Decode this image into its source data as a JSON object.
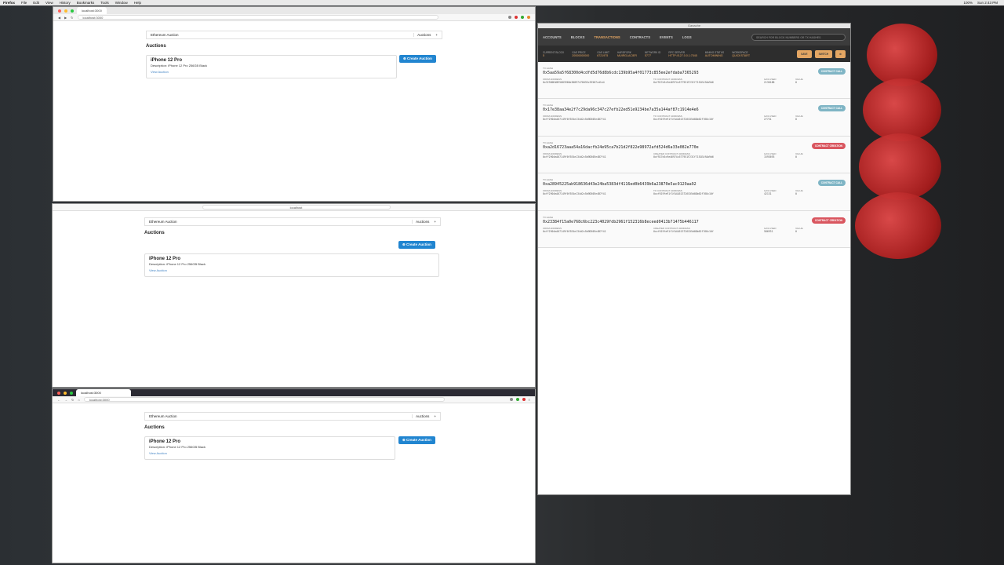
{
  "menubar": {
    "items": [
      "Firefox",
      "File",
      "Edit",
      "View",
      "History",
      "Bookmarks",
      "Tools",
      "Window",
      "Help"
    ],
    "right": [
      "100%",
      "Sun 2:43 PM"
    ]
  },
  "windows": [
    {
      "tab": "localhost:3000",
      "url": "localhost:3000",
      "brand": "Ethereum Auction",
      "account": "Auctions",
      "heading": "Auctions",
      "create_label": "Create Auction",
      "card": {
        "title": "iPhone 12 Pro",
        "desc": "Description: iPhone 12 Pro 256GB Black",
        "link": "View Auction"
      }
    },
    {
      "tab": "",
      "url": "localhost",
      "brand": "Ethereum Auction",
      "account": "Auctions",
      "heading": "Auctions",
      "create_label": "Create Auction",
      "card": {
        "title": "iPhone 12 Pro",
        "desc": "Description: iPhone 12 Pro 256GB Black",
        "link": "View Auction"
      }
    },
    {
      "tab": "localhost:3000",
      "url": "localhost:3000",
      "brand": "Ethereum Auction",
      "account": "Auctions",
      "heading": "Auctions",
      "create_label": "Create Auction",
      "card": {
        "title": "iPhone 12 Pro",
        "desc": "Description: iPhone 12 Pro 256GB Black",
        "link": "View Auction"
      }
    }
  ],
  "ganache": {
    "title": "Ganache",
    "nav": [
      "ACCOUNTS",
      "BLOCKS",
      "TRANSACTIONS",
      "CONTRACTS",
      "EVENTS",
      "LOGS"
    ],
    "search_placeholder": "SEARCH FOR BLOCK NUMBERS OR TX HASHES",
    "stats": [
      {
        "label": "CURRENT BLOCK",
        "value": "5"
      },
      {
        "label": "GAS PRICE",
        "value": "20000000000"
      },
      {
        "label": "GAS LIMIT",
        "value": "6721975"
      },
      {
        "label": "HARDFORK",
        "value": "MUIRGLACIER"
      },
      {
        "label": "NETWORK ID",
        "value": "5777"
      },
      {
        "label": "RPC SERVER",
        "value": "HTTP://127.0.0.1:7545"
      },
      {
        "label": "MINING STATUS",
        "value": "AUTOMINING"
      },
      {
        "label": "WORKSPACE",
        "value": "QUICKSTART"
      }
    ],
    "buttons": [
      "SAVE",
      "SWITCH"
    ],
    "labels": {
      "tx_hash": "TX HASH",
      "from": "FROM ADDRESS",
      "to_contract": "TO CONTRACT ADDRESS",
      "created_contract": "CREATED CONTRACT ADDRESS",
      "gas_used": "GAS USED",
      "value": "VALUE"
    },
    "transactions": [
      {
        "hash": "0x5aa59a5f68300d4cdfd5d76d8b6cdc139b95a4f01773c855ee2efdaba7365293",
        "from": "0x3C380EdBE5083960e30897470035c33587cd1e4",
        "to": "0xf927e3c9e46974c577951F23Cf7151EAfAb9d6",
        "gas": "2136188",
        "value": "0",
        "type": "CONTRACT CALL",
        "kind": "to_contract"
      },
      {
        "hash": "0x17e38aa34e2f7c29da96c347c27efb22ed51e9234be7a35a144af87c1914e4e6",
        "from": "0xff2904eA67149f0f3E4e134d2c5b9D50Ee4B7f41",
        "to": "0xcf619fe91f1fA4A513726C05d0Db62f768c10f",
        "gas": "27731",
        "value": "0",
        "type": "CONTRACT CALL",
        "kind": "to_contract"
      },
      {
        "hash": "0xa2d16723aaa54a16dacfb24e95ca7b21d2f822e98972afd524d6a33e082e770e",
        "from": "0xff2904eA67149f0f3E4e134d2c5b9D50Ee4B7f41",
        "to": "0xf927e3c9e46974c577951F23Cf7151EAfAb9d6",
        "gas": "1593693",
        "value": "0",
        "type": "CONTRACT CREATION",
        "kind": "created_contract"
      },
      {
        "hash": "0xa28945225ab918636d43e24ba5383df4116ed0b6439b6a23870e5ac9129aa92",
        "from": "0xff2904eA67149f0f3E4e134d2c5b9D50Ee4B7f41",
        "to": "0xcf619fe91f1fA4A513726C05d0Db62f768c10f",
        "gas": "42131",
        "value": "0",
        "type": "CONTRACT CALL",
        "kind": "to_contract"
      },
      {
        "hash": "0x23384f15a0e768c6bc223c4029fdb2961f152316b8eceed0413b71475b446117",
        "from": "0xff2904eA67149f0f3E4e134d2c5b9D50Ee4B7f41",
        "to": "0xcf619fe91f1fA4A513726C05d0Db62f768c10f",
        "gas": "586931",
        "value": "0",
        "type": "CONTRACT CREATION",
        "kind": "created_contract"
      }
    ]
  },
  "colors": {
    "primary": "#2185d0",
    "ganache_accent": "#e4a663",
    "call_badge": "#7fb5c5",
    "create_badge": "#d9565f"
  }
}
